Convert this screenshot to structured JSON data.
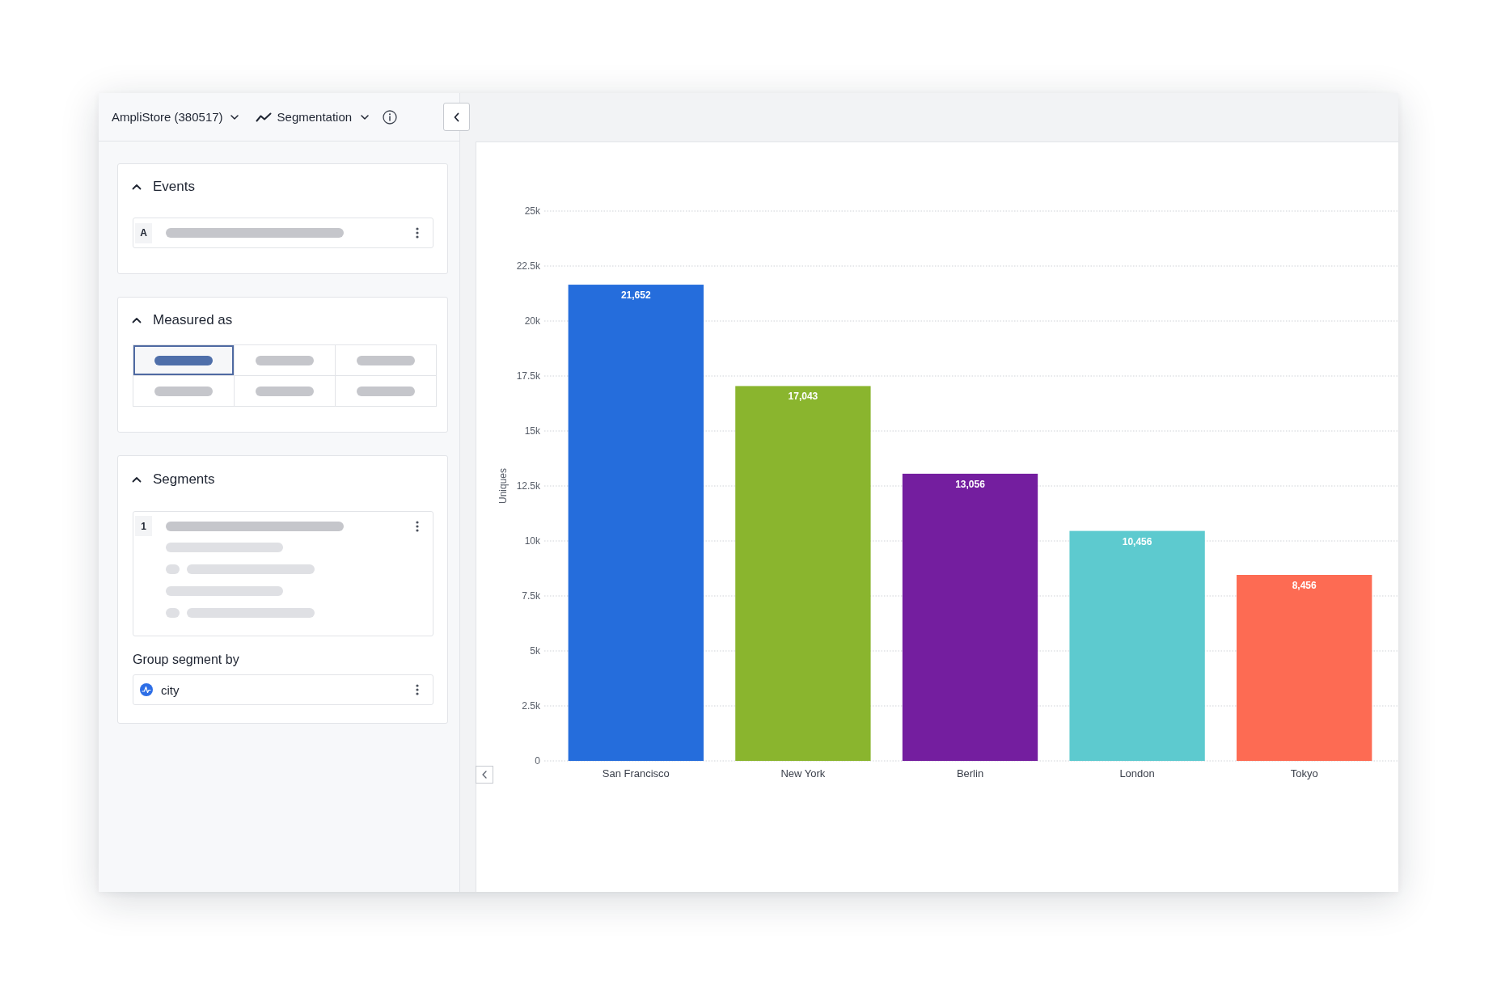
{
  "top_bar": {
    "project": "AmpliStore (380517)",
    "chart_type": "Segmentation"
  },
  "sidebar": {
    "sections": [
      {
        "kind": "events",
        "title": "Events",
        "expanded": true,
        "events": [
          {
            "label": "A"
          }
        ]
      },
      {
        "kind": "measured_as",
        "title": "Measured as",
        "expanded": true,
        "options": [
          {
            "selected": true
          },
          {
            "selected": false
          },
          {
            "selected": false
          },
          {
            "selected": false
          },
          {
            "selected": false
          },
          {
            "selected": false
          }
        ]
      },
      {
        "kind": "segments",
        "title": "Segments",
        "expanded": true,
        "segments": [
          {
            "label": "1"
          }
        ],
        "group_by": {
          "title": "Group segment by",
          "value": "city"
        }
      }
    ]
  },
  "chart": {
    "chart_data": {
      "type": "bar",
      "ylabel": "Uniques",
      "categories": [
        "San Francisco",
        "New York",
        "Berlin",
        "London",
        "Tokyo"
      ],
      "values": [
        21652,
        17043,
        13056,
        10456,
        8456
      ],
      "colors": [
        "#256ddc",
        "#8ab52e",
        "#741e9f",
        "#5dcacf",
        "#fd6b53"
      ],
      "value_labels": [
        "21,652",
        "17,043",
        "13,056",
        "10,456",
        "8,456"
      ],
      "grid": true,
      "ylim": [
        0,
        25000
      ],
      "yticks": [
        {
          "value": 0,
          "label": "0"
        },
        {
          "value": 2500,
          "label": "2.5k"
        },
        {
          "value": 5000,
          "label": "5k"
        },
        {
          "value": 7500,
          "label": "7.5k"
        },
        {
          "value": 10000,
          "label": "10k"
        },
        {
          "value": 12500,
          "label": "12.5k"
        },
        {
          "value": 15000,
          "label": "15k"
        },
        {
          "value": 17500,
          "label": "17.5k"
        },
        {
          "value": 20000,
          "label": "20k"
        },
        {
          "value": 22500,
          "label": "22.5k"
        },
        {
          "value": 25000,
          "label": "25k"
        }
      ]
    }
  }
}
